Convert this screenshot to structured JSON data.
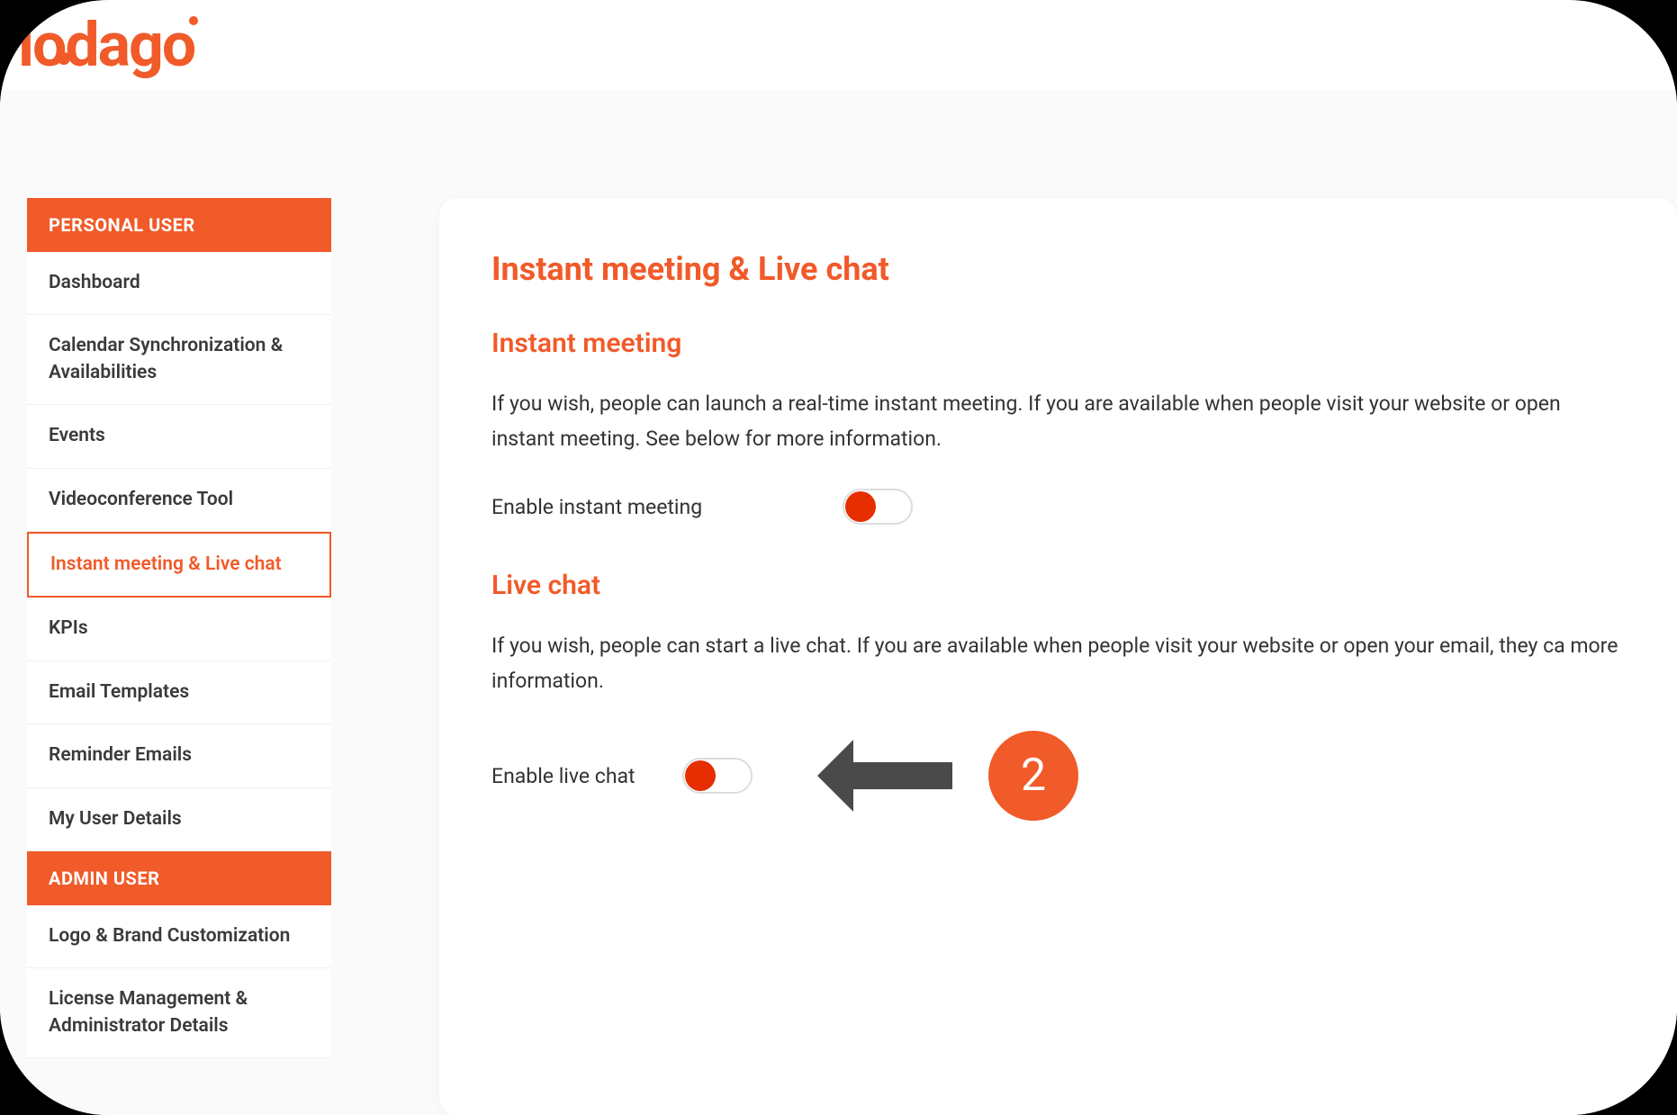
{
  "logo": {
    "text": "lodago"
  },
  "sidebar": {
    "sections": [
      {
        "header": "PERSONAL USER",
        "items": [
          {
            "label": "Dashboard",
            "active": false
          },
          {
            "label": "Calendar Synchronization & Availabilities",
            "active": false
          },
          {
            "label": "Events",
            "active": false
          },
          {
            "label": "Videoconference Tool",
            "active": false
          },
          {
            "label": "Instant meeting & Live chat",
            "active": true
          },
          {
            "label": "KPIs",
            "active": false
          },
          {
            "label": "Email Templates",
            "active": false
          },
          {
            "label": "Reminder Emails",
            "active": false
          },
          {
            "label": "My User Details",
            "active": false
          }
        ]
      },
      {
        "header": "ADMIN USER",
        "items": [
          {
            "label": "Logo & Brand Customization",
            "active": false
          },
          {
            "label": "License Management & Administrator Details",
            "active": false
          }
        ]
      }
    ]
  },
  "main": {
    "title": "Instant meeting & Live chat",
    "sections": [
      {
        "title": "Instant meeting",
        "description": "If you wish, people can launch a real-time instant meeting. If you are available when people visit your website or open instant meeting. See below for more information.",
        "toggleLabel": "Enable instant meeting",
        "toggleOn": false
      },
      {
        "title": "Live chat",
        "description": "If you wish, people can start a live chat. If you are available when people visit your website or open your email, they ca more information.",
        "toggleLabel": "Enable live chat",
        "toggleOn": false
      }
    ]
  },
  "annotation": {
    "stepNumber": "2"
  }
}
